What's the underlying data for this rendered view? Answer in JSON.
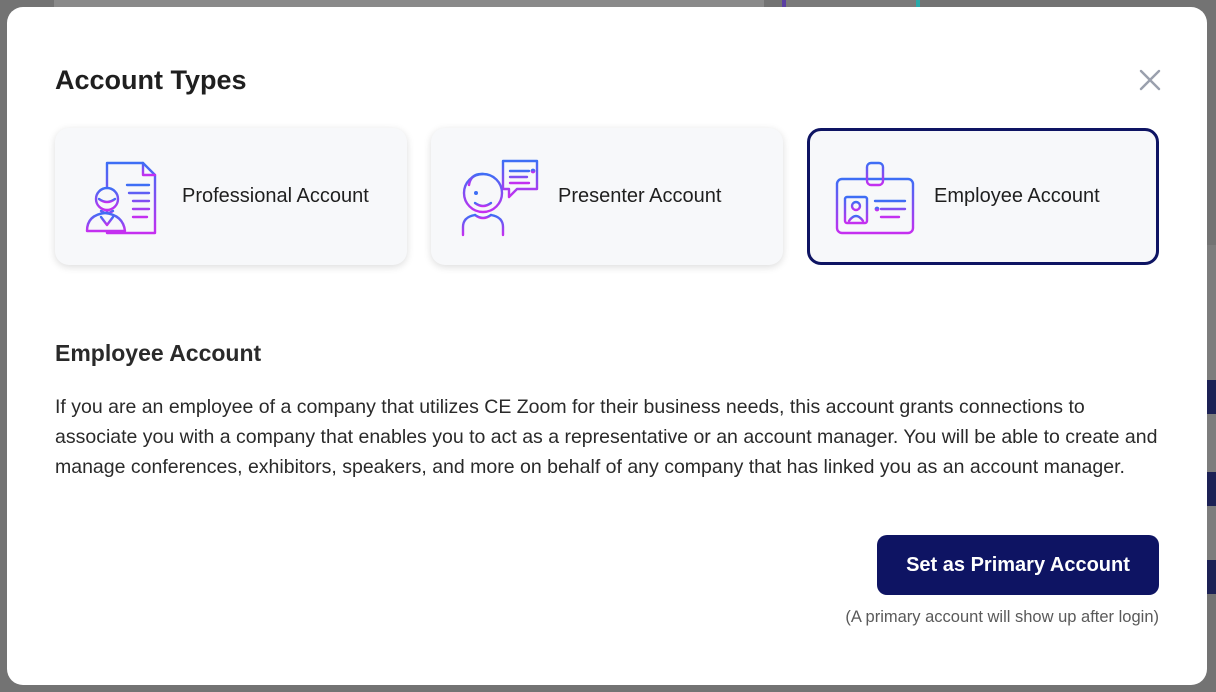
{
  "modal": {
    "title": "Account Types",
    "close_icon": "close-icon"
  },
  "account_types": [
    {
      "label": "Professional Account",
      "icon": "professional-document-person-icon",
      "selected": false
    },
    {
      "label": "Presenter Account",
      "icon": "presenter-speech-person-icon",
      "selected": false
    },
    {
      "label": "Employee Account",
      "icon": "employee-id-badge-icon",
      "selected": true
    }
  ],
  "details": {
    "title": "Employee Account",
    "description": "If you are an employee of a company that utilizes CE Zoom for their business needs, this account grants connections to associate you with a company that enables you to act as a representative or an account manager. You will be able to create and manage conferences, exhibitors, speakers, and more on behalf of any company that has linked you as an account manager."
  },
  "actions": {
    "primary_button": "Set as Primary Account",
    "note": "(A primary account will show up after login)"
  },
  "colors": {
    "accent": "#0e1463",
    "icon_gradient_start": "#3d6ef5",
    "icon_gradient_end": "#c52ff0",
    "card_background": "#f7f8fa"
  }
}
